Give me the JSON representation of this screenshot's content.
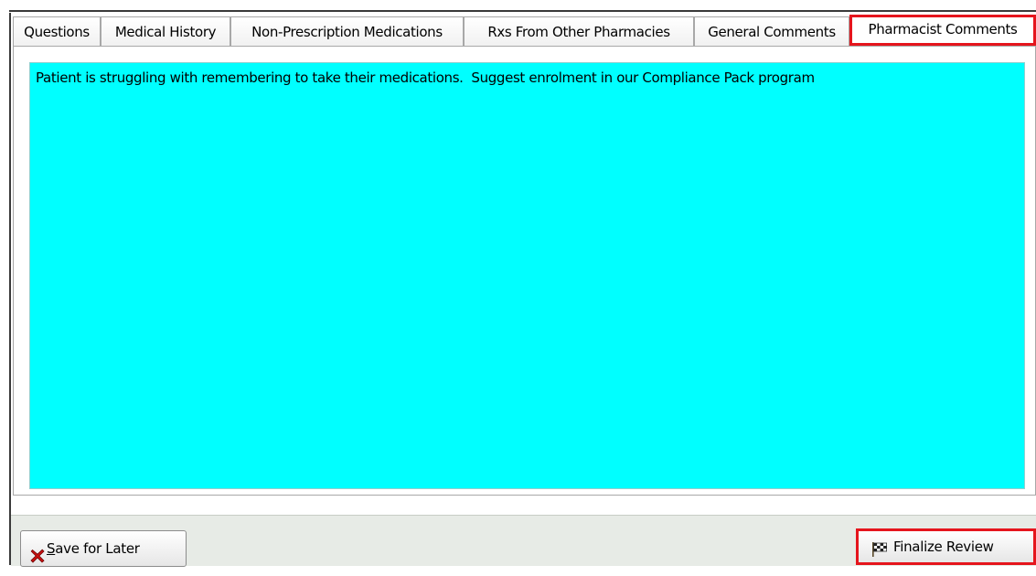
{
  "tabs": [
    {
      "label": "Questions"
    },
    {
      "label": "Medical History"
    },
    {
      "label": "Non-Prescription Medications"
    },
    {
      "label": "Rxs From Other Pharmacies"
    },
    {
      "label": "General Comments"
    },
    {
      "label": "Pharmacist Comments",
      "active": true
    }
  ],
  "pharmacist_comments": {
    "text": "Patient is struggling with remembering to take their medications.  Suggest enrolment in our Compliance Pack program"
  },
  "buttons": {
    "save_mnemonic": "S",
    "save_rest": "ave for Later",
    "finalize_label": "Finalize Review"
  },
  "icons": {
    "save": "x-icon",
    "finalize": "checkered-flag-icon"
  },
  "colors": {
    "notes_background": "#00ffff",
    "highlight": "#e5151d"
  }
}
